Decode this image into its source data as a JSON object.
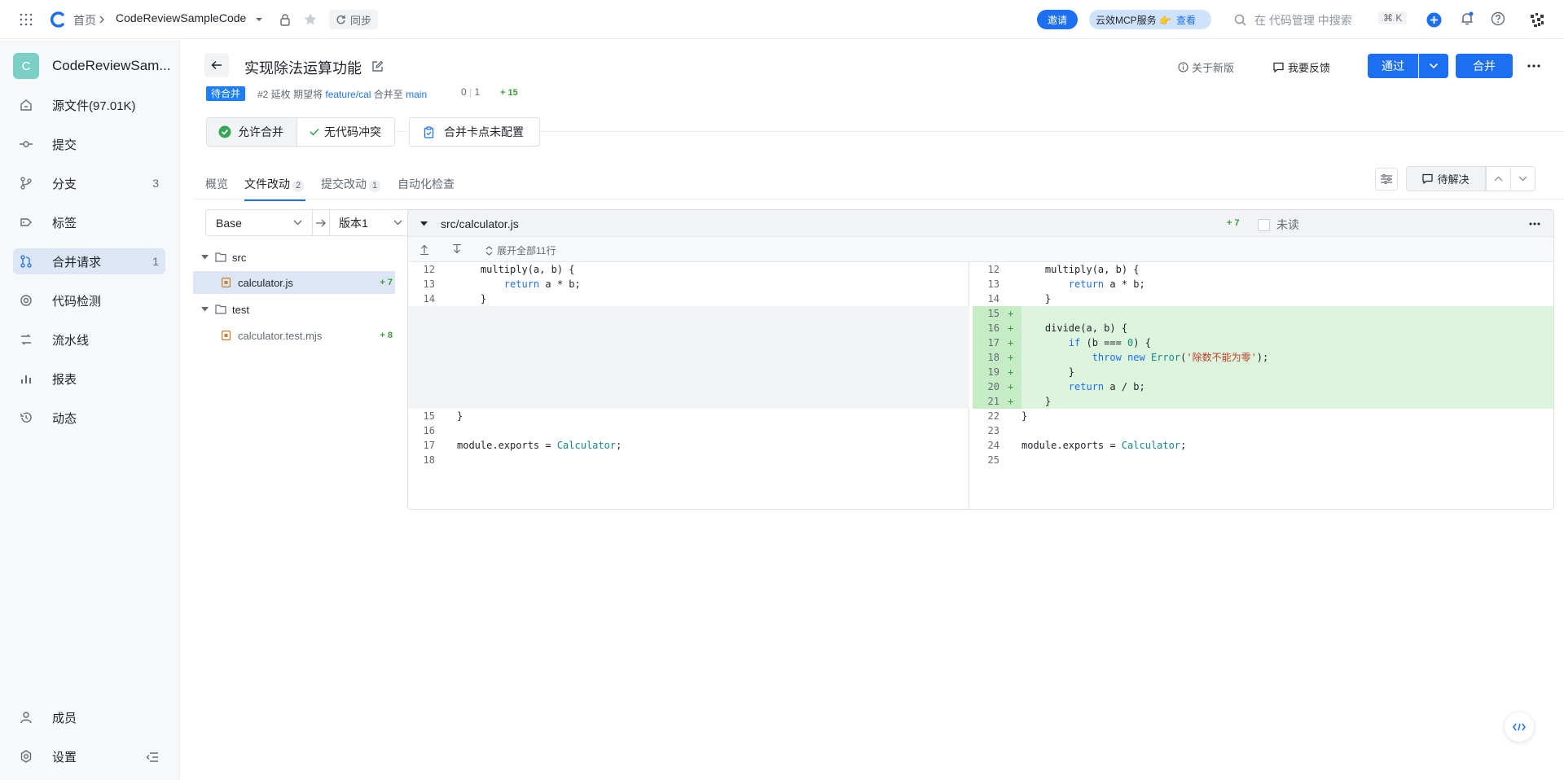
{
  "topbar": {
    "breadcrumb_home": "首页",
    "repo_name": "CodeReviewSampleCode",
    "sync_label": "同步",
    "invite_label": "邀请",
    "mcp_label": "云效MCP服务 👉",
    "mcp_view": "查看",
    "search_placeholder": "在 代码管理 中搜索",
    "shortcut": "⌘ K"
  },
  "sidebar": {
    "repo_initial": "C",
    "repo_name": "CodeReviewSam...",
    "items": [
      {
        "label": "源文件(97.01K)",
        "count": ""
      },
      {
        "label": "提交",
        "count": ""
      },
      {
        "label": "分支",
        "count": "3"
      },
      {
        "label": "标签",
        "count": ""
      },
      {
        "label": "合并请求",
        "count": "1"
      },
      {
        "label": "代码检测",
        "count": ""
      },
      {
        "label": "流水线",
        "count": ""
      },
      {
        "label": "报表",
        "count": ""
      },
      {
        "label": "动态",
        "count": ""
      }
    ],
    "members": "成员",
    "settings": "设置"
  },
  "mr": {
    "title": "实现除法运算功能",
    "status": "待合并",
    "meta_prefix": "#2 延枚 期望将",
    "source_branch": "feature/cal",
    "merge_to": "合并至",
    "target_branch": "main",
    "commits_a": "0",
    "commits_b": "1",
    "additions": "+ 15",
    "about_new": "关于新版",
    "feedback": "我要反馈",
    "approve": "通过",
    "merge": "合并",
    "check_allow": "允许合并",
    "check_conflict": "无代码冲突",
    "check_gate": "合并卡点未配置"
  },
  "tabs": [
    {
      "label": "概览",
      "badge": ""
    },
    {
      "label": "文件改动",
      "badge": "2"
    },
    {
      "label": "提交改动",
      "badge": "1"
    },
    {
      "label": "自动化检查",
      "badge": ""
    }
  ],
  "toolbar": {
    "pending": "待解决"
  },
  "compare": {
    "base": "Base",
    "version": "版本1"
  },
  "tree": {
    "folder_src": "src",
    "file_calc": "calculator.js",
    "file_calc_add": "+ 7",
    "folder_test": "test",
    "file_test": "calculator.test.mjs",
    "file_test_add": "+ 8"
  },
  "diff": {
    "file_path": "src/calculator.js",
    "additions": "+ 7",
    "unread": "未读",
    "expand_all": "展开全部11行",
    "left_lines": [
      {
        "n": "12",
        "code": "    multiply(a, b) {"
      },
      {
        "n": "13",
        "code": "        return a * b;"
      },
      {
        "n": "14",
        "code": "    }"
      },
      {
        "n": "15",
        "code": "}"
      },
      {
        "n": "16",
        "code": ""
      },
      {
        "n": "17",
        "code": "module.exports = Calculator;"
      },
      {
        "n": "18",
        "code": ""
      }
    ],
    "right_lines": [
      {
        "n": "12",
        "code": "    multiply(a, b) {"
      },
      {
        "n": "13",
        "code": "        return a * b;"
      },
      {
        "n": "14",
        "code": "    }"
      },
      {
        "n": "15",
        "code": ""
      },
      {
        "n": "16",
        "code": "    divide(a, b) {"
      },
      {
        "n": "17",
        "code": "        if (b === 0) {"
      },
      {
        "n": "18",
        "code": "            throw new Error('除数不能为零');"
      },
      {
        "n": "19",
        "code": "        }"
      },
      {
        "n": "20",
        "code": "        return a / b;"
      },
      {
        "n": "21",
        "code": "    }"
      },
      {
        "n": "22",
        "code": "}"
      },
      {
        "n": "23",
        "code": ""
      },
      {
        "n": "24",
        "code": "module.exports = Calculator;"
      },
      {
        "n": "25",
        "code": ""
      }
    ]
  },
  "colors": {
    "accent": "#1d6ff2",
    "added_bg": "#dcf5dc",
    "sidebar_active": "#dde6f5"
  }
}
